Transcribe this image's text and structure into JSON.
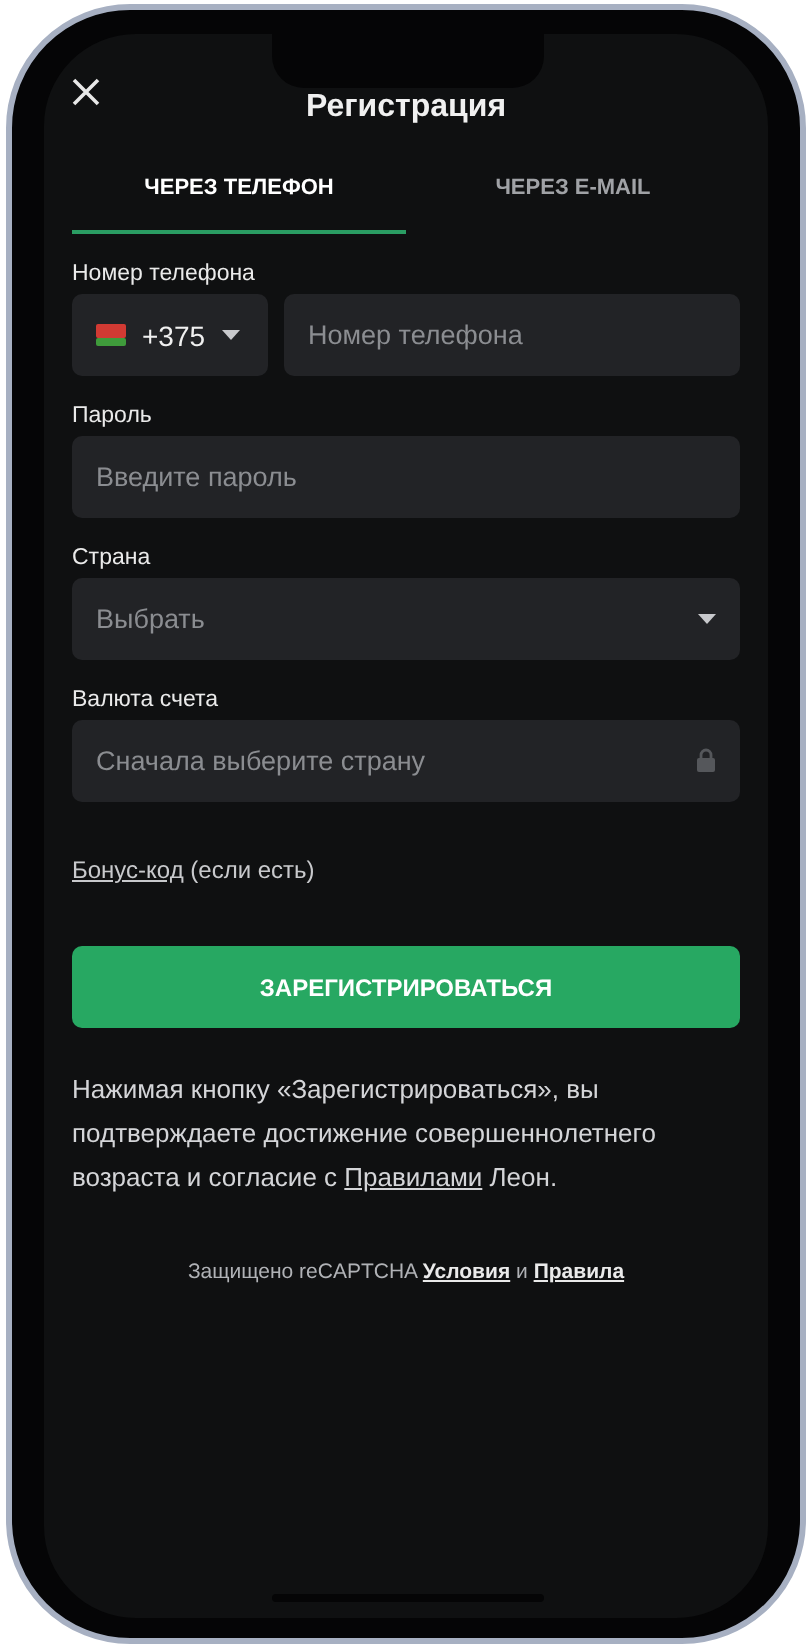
{
  "header": {
    "title": "Регистрация"
  },
  "tabs": [
    {
      "label": "ЧЕРЕЗ ТЕЛЕФОН",
      "selected": true
    },
    {
      "label": "ЧЕРЕЗ E-MAIL",
      "selected": false
    }
  ],
  "fields": [
    {
      "kind": "phone",
      "label": "Номер телефона",
      "code": "+375",
      "placeholder": "Номер телефона"
    },
    {
      "kind": "text",
      "label": "Пароль",
      "placeholder": "Введите пароль"
    },
    {
      "kind": "select",
      "label": "Страна",
      "value": "Выбрать"
    },
    {
      "kind": "locked",
      "label": "Валюта счета",
      "placeholder": "Сначала выберите страну"
    }
  ],
  "bonus": {
    "link": "Бонус-код",
    "note": "(если есть)"
  },
  "submit_button": "ЗАРЕГИСТРИРОВАТЬСЯ",
  "consent": {
    "before": "Нажимая кнопку «Зарегистрироваться», вы подтверждаете достижение совершеннолетнего возраста и согласие с",
    "link": "Правилами",
    "after": "Леон."
  },
  "recaptcha": {
    "text": "Защищено reCAPTCHA",
    "terms_link": "Условия",
    "joiner": "и",
    "privacy_link": "Правила"
  }
}
